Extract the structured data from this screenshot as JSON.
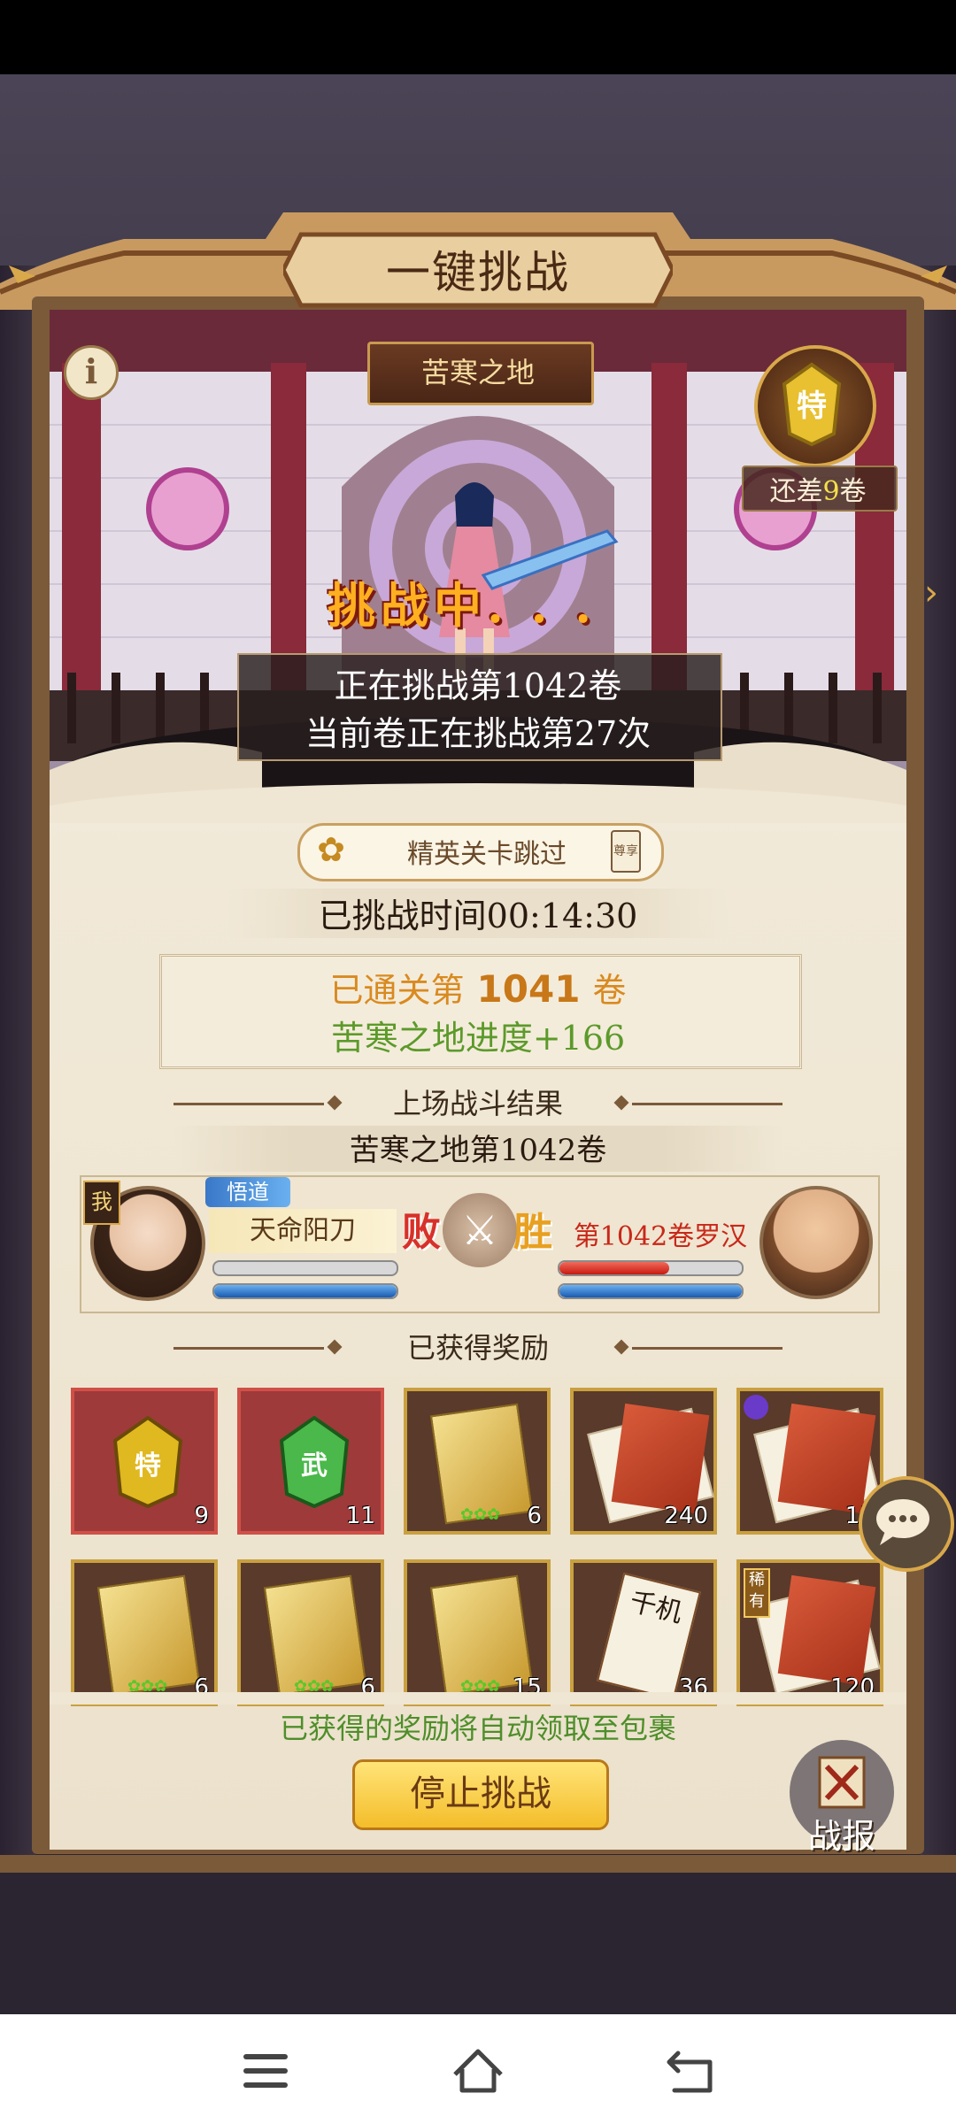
{
  "header": {
    "title": "一键挑战",
    "stage_name": "苦寒之地",
    "remaining_prefix": "还差",
    "remaining_count": "9",
    "remaining_suffix": "卷",
    "token_glyph": "特",
    "info_glyph": "i"
  },
  "scene": {
    "status": "挑战中. . .",
    "line1": "正在挑战第1042卷",
    "line2": "当前卷正在挑战第27次"
  },
  "skip": {
    "label": "精英关卡跳过",
    "badge": "尊享"
  },
  "elapsed": "已挑战时间00:14:30",
  "cleared": {
    "prefix": "已通关第",
    "number": "1041",
    "suffix": "卷",
    "progress": "苦寒之地进度+166"
  },
  "last_battle": {
    "heading": "上场战斗结果",
    "stage": "苦寒之地第1042卷",
    "me_tag": "我",
    "my_tag2": "悟道",
    "my_skill": "天命阳刀",
    "my_hp": 0.0,
    "my_mp": 1.0,
    "lose": "败",
    "win": "胜",
    "enemy_name": "第1042卷罗汉",
    "enemy_hp": 0.6,
    "enemy_mp": 1.0
  },
  "rewards": {
    "heading": "已获得奖励",
    "items": [
      {
        "name": "special-token",
        "glyph": "特",
        "count": "9",
        "style": "red"
      },
      {
        "name": "martial-jade",
        "glyph": "武",
        "count": "11",
        "style": "red"
      },
      {
        "name": "skill-card-1",
        "count": "6",
        "style": "brown"
      },
      {
        "name": "secret-manual-1",
        "count": "240",
        "style": "brown"
      },
      {
        "name": "secret-manual-2",
        "count": "15",
        "style": "brown"
      },
      {
        "name": "skill-card-2",
        "count": "6",
        "style": "brown"
      },
      {
        "name": "skill-card-3",
        "count": "6",
        "style": "brown"
      },
      {
        "name": "skill-card-4",
        "count": "15",
        "style": "brown"
      },
      {
        "name": "qianji-scroll",
        "glyph": "千机",
        "count": "36",
        "style": "brown"
      },
      {
        "name": "rare-manual",
        "tag": "稀有",
        "count": "120",
        "style": "brown"
      }
    ],
    "note": "已获得的奖励将自动领取至包裹"
  },
  "actions": {
    "stop": "停止挑战",
    "report": "战报"
  },
  "colors": {
    "accent_gold": "#f4bd2a",
    "win_orange": "#e8a020",
    "lose_red": "#d8302a",
    "progress_green": "#5c9a2a"
  }
}
